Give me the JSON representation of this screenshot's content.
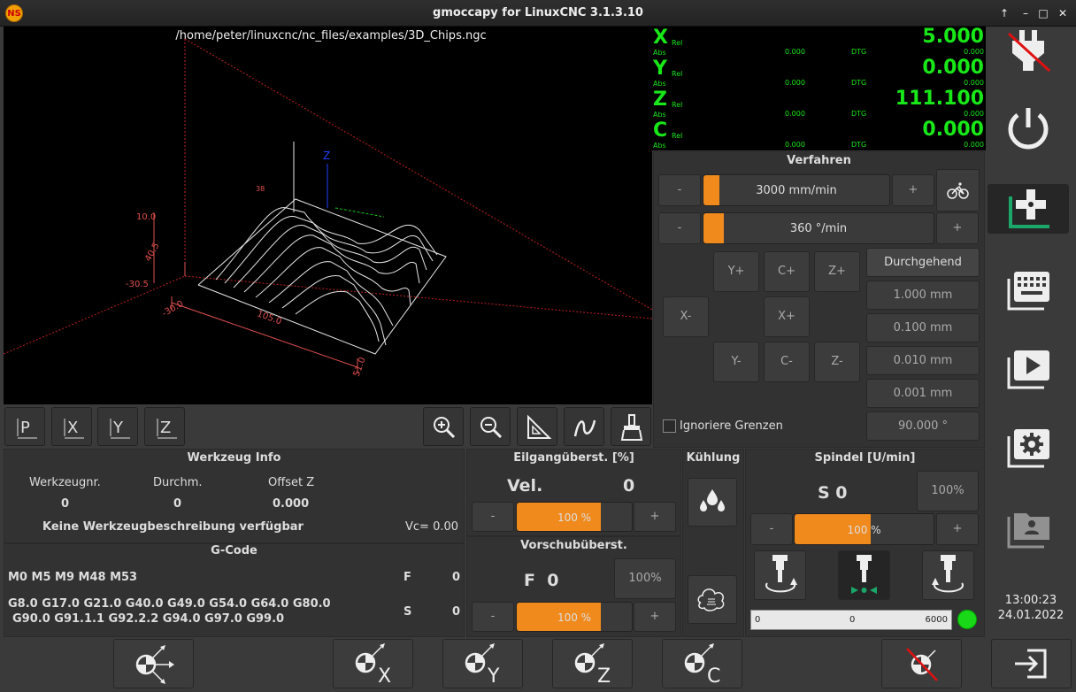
{
  "window": {
    "title": "gmoccapy for LinuxCNC  3.1.3.10",
    "app_icon": "NS"
  },
  "preview": {
    "filename": "/home/peter/linuxcnc/nc_files/examples/3D_Chips.ngc",
    "labels": {
      "z_axis": "Z",
      "y_axis": "Y",
      "dim_left_top": "10.0",
      "dim_left_a": "40.5",
      "dim_left_b": "-30.5",
      "dim_bottom_left": "-30.0",
      "dim_bottom_mid": "105.0",
      "dim_bottom_right": "51.0",
      "dim_top": "38"
    }
  },
  "view_buttons": {
    "p": "P",
    "x": "X",
    "y": "Y",
    "z": "Z"
  },
  "dro": {
    "x": {
      "label": "X",
      "rel": "Rel",
      "abs": "Abs",
      "abs_val": "0.000",
      "dtg": "DTG",
      "dtg_val": "0.000",
      "val": "5.000"
    },
    "y": {
      "label": "Y",
      "rel": "Rel",
      "abs": "Abs",
      "abs_val": "0.000",
      "dtg": "DTG",
      "dtg_val": "0.000",
      "val": "0.000"
    },
    "z": {
      "label": "Z",
      "rel": "Rel",
      "abs": "Abs",
      "abs_val": "0.000",
      "dtg": "DTG",
      "dtg_val": "0.000",
      "val": "111.100"
    },
    "c": {
      "label": "C",
      "rel": "Rel",
      "abs": "Abs",
      "abs_val": "0.000",
      "dtg": "DTG",
      "dtg_val": "0.000",
      "val": "0.000"
    }
  },
  "jog": {
    "title": "Verfahren",
    "minus": "-",
    "plus": "+",
    "linear_speed": "3000 mm/min",
    "linear_fraction": 0.087,
    "angular_speed": "360 °/min",
    "angular_fraction": 0.09,
    "buttons": {
      "yp": "Y+",
      "cp": "C+",
      "zp": "Z+",
      "xm": "X-",
      "xp": "X+",
      "ym": "Y-",
      "cm": "C-",
      "zm": "Z-"
    },
    "increments": [
      "Durchgehend",
      "1.000 mm",
      "0.100 mm",
      "0.010 mm",
      "0.001 mm",
      "90.000 °"
    ],
    "ignore_limits": "Ignoriere Grenzen"
  },
  "tool": {
    "title": "Werkzeug Info",
    "h_nr": "Werkzeugnr.",
    "h_dia": "Durchm.",
    "h_off": "Offset Z",
    "nr": "0",
    "dia": "0",
    "off": "0.000",
    "desc": "Keine Werkzeugbeschreibung verfügbar",
    "vc": "Vc= 0.00"
  },
  "gcode": {
    "title": "G-Code",
    "mcodes": "M0 M5 M9 M48 M53",
    "gcodes_1": "G8.0 G17.0 G21.0 G40.0 G49.0 G54.0 G64.0 G80.0",
    "gcodes_2": "G90.0 G91.1.1 G92.2.2 G94.0 G97.0 G99.0",
    "f_label": "F",
    "f_val": "0",
    "s_label": "S",
    "s_val": "0"
  },
  "rapid": {
    "title": "Eilgangüberst. [%]",
    "vel_label": "Vel.",
    "vel_val": "0",
    "slider": "100 %",
    "fraction": 0.73
  },
  "feed": {
    "title": "Vorschubüberst.",
    "f_label": "F  0",
    "pct": "100%",
    "slider": "100 %",
    "fraction": 0.73
  },
  "cool": {
    "title": "Kühlung"
  },
  "spindle": {
    "title": "Spindel [U/min]",
    "s_label": "S 0",
    "pct": "100%",
    "slider": "100 %",
    "fraction": 0.55,
    "bar_min": "0",
    "bar_mid": "0",
    "bar_max": "6000"
  },
  "clock": {
    "time": "13:00:23",
    "date": "24.01.2022"
  },
  "bottom": {
    "x": "X",
    "y": "Y",
    "z": "Z",
    "c": "C"
  },
  "colors": {
    "accent": "#f08a1c",
    "dro_green": "#18e818",
    "led": "#18d818",
    "home_teal": "#1aa86a"
  }
}
